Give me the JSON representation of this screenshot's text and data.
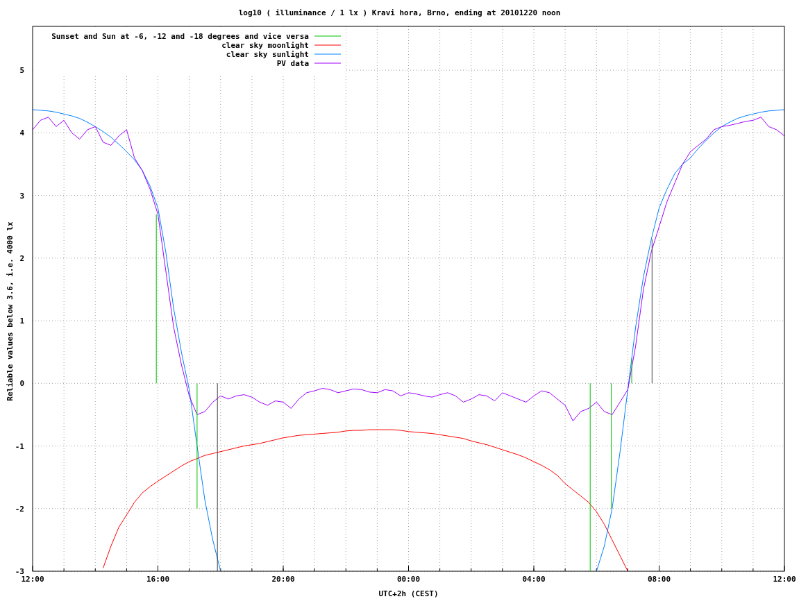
{
  "chart_data": {
    "type": "line",
    "title": "log10 ( illuminance / 1 lx ) Kravi hora, Brno, ending at 20101220 noon",
    "xlabel": "UTC+2h (CEST)",
    "ylabel": "Reliable values below 3.6, i.e. 4000 lx",
    "ylim": [
      -3,
      5.7
    ],
    "categories": [
      "12:00",
      null,
      null,
      null,
      null,
      null,
      null,
      null,
      null,
      null,
      null,
      null,
      null,
      null,
      null,
      null,
      "16:00",
      null,
      null,
      null,
      null,
      null,
      null,
      null,
      null,
      null,
      null,
      null,
      null,
      null,
      null,
      null,
      "20:00",
      null,
      null,
      null,
      null,
      null,
      null,
      null,
      null,
      null,
      null,
      null,
      null,
      null,
      null,
      null,
      "00:00",
      null,
      null,
      null,
      null,
      null,
      null,
      null,
      null,
      null,
      null,
      null,
      null,
      null,
      null,
      null,
      "04:00",
      null,
      null,
      null,
      null,
      null,
      null,
      null,
      null,
      null,
      null,
      null,
      null,
      null,
      null,
      null,
      "08:00",
      null,
      null,
      null,
      null,
      null,
      null,
      null,
      null,
      null,
      null,
      null,
      null,
      null,
      null,
      null,
      "12:00"
    ],
    "yticks": [
      -3,
      -2,
      -1,
      0,
      1,
      2,
      3,
      4,
      5
    ],
    "series": [
      {
        "name": "Sunset and Sun at -6, -12 and -18 degrees and vice versa",
        "color": "#00c000",
        "values": [
          null,
          null,
          null,
          null,
          null,
          null,
          null,
          null,
          null,
          null,
          null,
          null,
          null,
          null,
          null,
          null,
          null,
          null,
          null,
          null,
          null,
          null,
          null,
          null,
          null,
          null,
          null,
          null,
          null,
          null,
          null,
          null,
          null,
          null,
          null,
          null,
          null,
          null,
          null,
          null,
          null,
          null,
          null,
          null,
          null,
          null,
          null,
          null,
          null,
          null,
          null,
          null,
          null,
          null,
          null,
          null,
          null,
          null,
          null,
          null,
          null,
          null,
          null,
          null,
          null,
          null,
          null,
          null,
          null,
          null,
          null,
          null,
          null,
          null,
          null,
          null,
          null,
          null,
          null,
          null,
          null,
          null,
          null,
          null,
          null,
          null,
          null,
          null,
          null,
          null,
          null,
          null,
          null,
          null,
          null,
          null,
          null
        ]
      },
      {
        "name": "clear sky moonlight",
        "color": "#ff0000",
        "values": [
          null,
          null,
          null,
          null,
          null,
          null,
          null,
          null,
          null,
          -2.95,
          -2.6,
          -2.3,
          -2.1,
          -1.9,
          -1.75,
          -1.65,
          -1.56,
          -1.48,
          -1.4,
          -1.32,
          -1.25,
          -1.2,
          -1.15,
          -1.12,
          -1.09,
          -1.06,
          -1.03,
          -1.0,
          -0.98,
          -0.96,
          -0.93,
          -0.9,
          -0.87,
          -0.85,
          -0.83,
          -0.82,
          -0.81,
          -0.8,
          -0.79,
          -0.78,
          -0.76,
          -0.75,
          -0.75,
          -0.74,
          -0.74,
          -0.74,
          -0.74,
          -0.75,
          -0.77,
          -0.78,
          -0.79,
          -0.8,
          -0.82,
          -0.84,
          -0.86,
          -0.88,
          -0.92,
          -0.95,
          -0.98,
          -1.02,
          -1.06,
          -1.1,
          -1.14,
          -1.19,
          -1.25,
          -1.31,
          -1.38,
          -1.47,
          -1.6,
          -1.7,
          -1.8,
          -1.9,
          -2.05,
          -2.25,
          -2.5,
          -2.75,
          -3.0,
          null,
          null,
          null,
          null,
          null,
          null,
          null,
          null,
          null,
          null,
          null,
          null,
          null,
          null,
          null,
          null,
          null,
          null,
          null,
          null
        ]
      },
      {
        "name": "clear sky sunlight",
        "color": "#0080ff",
        "values": [
          4.37,
          4.36,
          4.35,
          4.33,
          4.3,
          4.27,
          4.23,
          4.17,
          4.1,
          4.02,
          3.93,
          3.82,
          3.7,
          3.57,
          3.4,
          3.15,
          2.8,
          2.1,
          1.2,
          0.5,
          -0.1,
          -1.0,
          -1.87,
          -2.5,
          -3,
          null,
          null,
          null,
          null,
          null,
          null,
          null,
          null,
          null,
          null,
          null,
          null,
          null,
          null,
          null,
          null,
          null,
          null,
          null,
          null,
          null,
          null,
          null,
          null,
          null,
          null,
          null,
          null,
          null,
          null,
          null,
          null,
          null,
          null,
          null,
          null,
          null,
          null,
          null,
          null,
          null,
          null,
          null,
          null,
          null,
          null,
          null,
          -3,
          -2.6,
          -2.0,
          -1.1,
          -0.1,
          0.9,
          1.7,
          2.3,
          2.8,
          3.1,
          3.35,
          3.5,
          3.6,
          3.75,
          3.88,
          4.0,
          4.1,
          4.17,
          4.23,
          4.27,
          4.3,
          4.33,
          4.35,
          4.36,
          4.37
        ]
      },
      {
        "name": "PV data",
        "color": "#a000ff",
        "values": [
          4.05,
          4.2,
          4.25,
          4.1,
          4.2,
          4.0,
          3.9,
          4.05,
          4.1,
          3.85,
          3.8,
          3.95,
          4.05,
          3.6,
          3.4,
          3.1,
          2.7,
          1.8,
          0.9,
          0.3,
          -0.2,
          -0.5,
          -0.45,
          -0.3,
          -0.2,
          -0.25,
          -0.2,
          -0.18,
          -0.22,
          -0.3,
          -0.35,
          -0.28,
          -0.3,
          -0.4,
          -0.25,
          -0.15,
          -0.12,
          -0.08,
          -0.1,
          -0.15,
          -0.12,
          -0.09,
          -0.1,
          -0.14,
          -0.15,
          -0.1,
          -0.12,
          -0.2,
          -0.15,
          -0.17,
          -0.2,
          -0.22,
          -0.18,
          -0.15,
          -0.2,
          -0.3,
          -0.25,
          -0.18,
          -0.2,
          -0.28,
          -0.15,
          -0.2,
          -0.25,
          -0.3,
          -0.2,
          -0.12,
          -0.15,
          -0.25,
          -0.35,
          -0.6,
          -0.45,
          -0.4,
          -0.3,
          -0.45,
          -0.5,
          -0.3,
          -0.1,
          0.6,
          1.5,
          2.1,
          2.5,
          2.9,
          3.2,
          3.5,
          3.7,
          3.8,
          3.9,
          4.05,
          4.1,
          4.12,
          4.15,
          4.18,
          4.2,
          4.25,
          4.1,
          4.05,
          3.95
        ]
      }
    ],
    "grid": true,
    "legend": true
  }
}
